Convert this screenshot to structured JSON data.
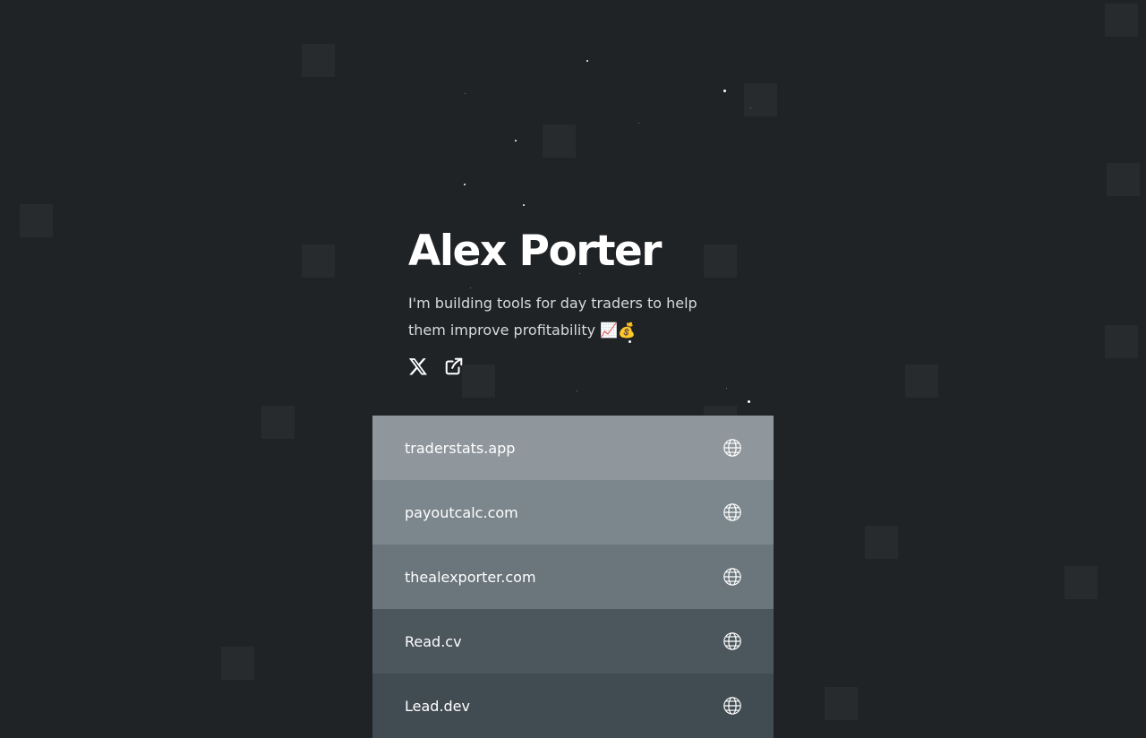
{
  "profile": {
    "name": "Alex Porter",
    "bio": "I'm building tools for day traders to help them improve profitability 📈💰"
  },
  "socials": [
    {
      "icon": "x-twitter-icon"
    },
    {
      "icon": "external-link-icon"
    }
  ],
  "links": [
    {
      "label": "traderstats.app",
      "icon": "globe-icon"
    },
    {
      "label": "payoutcalc.com",
      "icon": "globe-icon"
    },
    {
      "label": "thealexporter.com",
      "icon": "globe-icon"
    },
    {
      "label": "Read.cv",
      "icon": "globe-icon"
    },
    {
      "label": "Lead.dev",
      "icon": "globe-icon"
    }
  ]
}
